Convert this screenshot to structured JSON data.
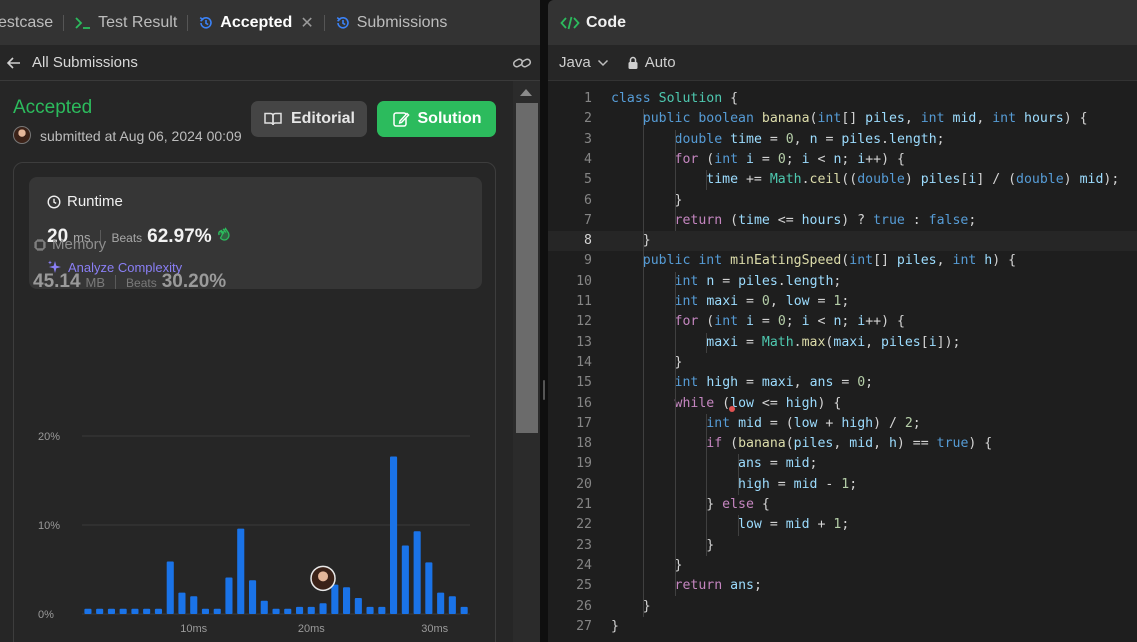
{
  "tabs": [
    {
      "label": "estcase",
      "active": false
    },
    {
      "label": "Test Result",
      "active": false
    },
    {
      "label": "Accepted",
      "active": true
    },
    {
      "label": "Submissions",
      "active": false
    }
  ],
  "subheader": {
    "back_label": "All Submissions"
  },
  "submission": {
    "status": "Accepted",
    "submitted_text": "submitted at Aug 06, 2024 00:09",
    "editorial_label": "Editorial",
    "solution_label": "Solution"
  },
  "runtime": {
    "title": "Runtime",
    "value": "20",
    "unit": "ms",
    "beats_label": "Beats",
    "beats": "62.97%",
    "analyze_label": "Analyze Complexity"
  },
  "memory": {
    "title": "Memory",
    "value": "45.14",
    "unit": "MB",
    "beats_label": "Beats",
    "beats": "30.20%"
  },
  "chart_data": {
    "type": "bar",
    "y_ticks": [
      "20%",
      "10%",
      "0%"
    ],
    "ylim": [
      0,
      20
    ],
    "x_ticks": [
      {
        "label": "10ms",
        "index": 9.5
      },
      {
        "label": "20ms",
        "index": 19.5
      },
      {
        "label": "30ms",
        "index": 30
      }
    ],
    "values": [
      0.6,
      0.6,
      0.6,
      0.6,
      0.6,
      0.6,
      0.6,
      5.9,
      2.4,
      2.0,
      0.6,
      0.6,
      4.1,
      9.6,
      3.8,
      1.5,
      0.6,
      0.6,
      0.8,
      0.8,
      1.2,
      3.3,
      3.0,
      1.8,
      0.8,
      0.8,
      17.7,
      7.7,
      9.3,
      5.8,
      2.4,
      2.0,
      0.8
    ],
    "user_index": 20,
    "colors": {
      "bar": "#1a73e8",
      "user_bar": "#1a73e8",
      "grid": "#3a3a3a"
    }
  },
  "code_panel": {
    "title": "Code",
    "language": "Java",
    "mode": "Auto",
    "lines": [
      "class Solution {",
      "    public boolean banana(int[] piles, int mid, int hours) {",
      "        double time = 0, n = piles.length;",
      "        for (int i = 0; i < n; i++) {",
      "            time += Math.ceil((double) piles[i] / (double) mid);",
      "        }",
      "        return (time <= hours) ? true : false;",
      "    }",
      "    public int minEatingSpeed(int[] piles, int h) {",
      "        int n = piles.length;",
      "        int maxi = 0, low = 1;",
      "        for (int i = 0; i < n; i++) {",
      "            maxi = Math.max(maxi, piles[i]);",
      "        }",
      "        int high = maxi, ans = 0;",
      "        while (low <= high) {",
      "            int mid = (low + high) / 2;",
      "            if (banana(piles, mid, h) == true) {",
      "                ans = mid;",
      "                high = mid - 1;",
      "            } else {",
      "                low = mid + 1;",
      "            }",
      "        }",
      "        return ans;",
      "    }",
      "}"
    ],
    "active_line": 8
  }
}
